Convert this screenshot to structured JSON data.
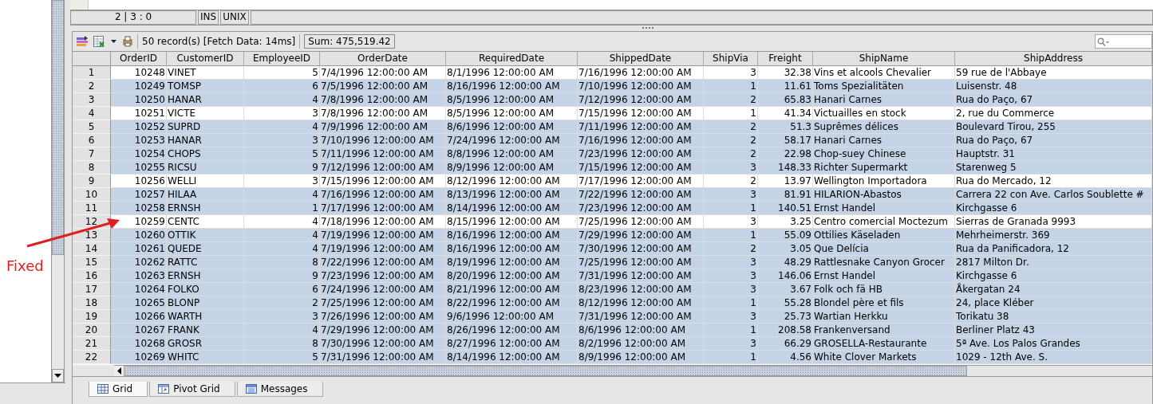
{
  "editor_status": {
    "position": "2 | 3 : 0",
    "mode": "INS",
    "line_ending": "UNIX"
  },
  "toolbar": {
    "record_info": "50 record(s) [Fetch Data: 14ms]",
    "sum": "Sum: 475,519.42"
  },
  "table": {
    "columns": [
      {
        "label": "OrderID",
        "kind": "number"
      },
      {
        "label": "CustomerID",
        "kind": "text"
      },
      {
        "label": "EmployeeID",
        "kind": "number"
      },
      {
        "label": "OrderDate",
        "kind": "text"
      },
      {
        "label": "RequiredDate",
        "kind": "text"
      },
      {
        "label": "ShippedDate",
        "kind": "text"
      },
      {
        "label": "ShipVia",
        "kind": "number"
      },
      {
        "label": "Freight",
        "kind": "number"
      },
      {
        "label": "ShipName",
        "kind": "text"
      },
      {
        "label": "ShipAddress",
        "kind": "text"
      }
    ],
    "rows": [
      {
        "number": "1",
        "selected": false,
        "cells": [
          "10248",
          "VINET",
          "5",
          "7/4/1996 12:00:00 AM",
          "8/1/1996 12:00:00 AM",
          "7/16/1996 12:00:00 AM",
          "3",
          "32.38",
          "Vins et alcools Chevalier",
          "59 rue de l'Abbaye"
        ]
      },
      {
        "number": "2",
        "selected": true,
        "cells": [
          "10249",
          "TOMSP",
          "6",
          "7/5/1996 12:00:00 AM",
          "8/16/1996 12:00:00 AM",
          "7/10/1996 12:00:00 AM",
          "1",
          "11.61",
          "Toms Spezialitäten",
          "Luisenstr. 48"
        ]
      },
      {
        "number": "3",
        "selected": true,
        "cells": [
          "10250",
          "HANAR",
          "4",
          "7/8/1996 12:00:00 AM",
          "8/5/1996 12:00:00 AM",
          "7/12/1996 12:00:00 AM",
          "2",
          "65.83",
          "Hanari Carnes",
          "Rua do Paço, 67"
        ]
      },
      {
        "number": "4",
        "selected": false,
        "cells": [
          "10251",
          "VICTE",
          "3",
          "7/8/1996 12:00:00 AM",
          "8/5/1996 12:00:00 AM",
          "7/15/1996 12:00:00 AM",
          "1",
          "41.34",
          "Victuailles en stock",
          "2, rue du Commerce"
        ]
      },
      {
        "number": "5",
        "selected": true,
        "cells": [
          "10252",
          "SUPRD",
          "4",
          "7/9/1996 12:00:00 AM",
          "8/6/1996 12:00:00 AM",
          "7/11/1996 12:00:00 AM",
          "2",
          "51.3",
          "Suprêmes délices",
          "Boulevard Tirou, 255"
        ]
      },
      {
        "number": "6",
        "selected": true,
        "cells": [
          "10253",
          "HANAR",
          "3",
          "7/10/1996 12:00:00 AM",
          "7/24/1996 12:00:00 AM",
          "7/16/1996 12:00:00 AM",
          "2",
          "58.17",
          "Hanari Carnes",
          "Rua do Paço, 67"
        ]
      },
      {
        "number": "7",
        "selected": true,
        "cells": [
          "10254",
          "CHOPS",
          "5",
          "7/11/1996 12:00:00 AM",
          "8/8/1996 12:00:00 AM",
          "7/23/1996 12:00:00 AM",
          "2",
          "22.98",
          "Chop-suey Chinese",
          "Hauptstr. 31"
        ]
      },
      {
        "number": "8",
        "selected": true,
        "cells": [
          "10255",
          "RICSU",
          "9",
          "7/12/1996 12:00:00 AM",
          "8/9/1996 12:00:00 AM",
          "7/15/1996 12:00:00 AM",
          "3",
          "148.33",
          "Richter Supermarkt",
          "Starenweg 5"
        ]
      },
      {
        "number": "9",
        "selected": false,
        "cells": [
          "10256",
          "WELLI",
          "3",
          "7/15/1996 12:00:00 AM",
          "8/12/1996 12:00:00 AM",
          "7/17/1996 12:00:00 AM",
          "2",
          "13.97",
          "Wellington Importadora",
          "Rua do Mercado, 12"
        ]
      },
      {
        "number": "10",
        "selected": true,
        "cells": [
          "10257",
          "HILAA",
          "4",
          "7/16/1996 12:00:00 AM",
          "8/13/1996 12:00:00 AM",
          "7/22/1996 12:00:00 AM",
          "3",
          "81.91",
          "HILARION-Abastos",
          "Carrera 22 con Ave. Carlos Soublette #"
        ]
      },
      {
        "number": "11",
        "selected": true,
        "cells": [
          "10258",
          "ERNSH",
          "1",
          "7/17/1996 12:00:00 AM",
          "8/14/1996 12:00:00 AM",
          "7/23/1996 12:00:00 AM",
          "1",
          "140.51",
          "Ernst Handel",
          "Kirchgasse 6"
        ]
      },
      {
        "number": "12",
        "selected": false,
        "cells": [
          "10259",
          "CENTC",
          "4",
          "7/18/1996 12:00:00 AM",
          "8/15/1996 12:00:00 AM",
          "7/25/1996 12:00:00 AM",
          "3",
          "3.25",
          "Centro comercial Moctezum",
          "Sierras de Granada 9993"
        ]
      },
      {
        "number": "13",
        "selected": true,
        "cells": [
          "10260",
          "OTTIK",
          "4",
          "7/19/1996 12:00:00 AM",
          "8/16/1996 12:00:00 AM",
          "7/29/1996 12:00:00 AM",
          "1",
          "55.09",
          "Ottilies Käseladen",
          "Mehrheimerstr. 369"
        ]
      },
      {
        "number": "14",
        "selected": true,
        "cells": [
          "10261",
          "QUEDE",
          "4",
          "7/19/1996 12:00:00 AM",
          "8/16/1996 12:00:00 AM",
          "7/30/1996 12:00:00 AM",
          "2",
          "3.05",
          "Que Delícia",
          "Rua da Panificadora, 12"
        ]
      },
      {
        "number": "15",
        "selected": true,
        "cells": [
          "10262",
          "RATTC",
          "8",
          "7/22/1996 12:00:00 AM",
          "8/19/1996 12:00:00 AM",
          "7/25/1996 12:00:00 AM",
          "3",
          "48.29",
          "Rattlesnake Canyon Grocer",
          "2817 Milton Dr."
        ]
      },
      {
        "number": "16",
        "selected": true,
        "cells": [
          "10263",
          "ERNSH",
          "9",
          "7/23/1996 12:00:00 AM",
          "8/20/1996 12:00:00 AM",
          "7/31/1996 12:00:00 AM",
          "3",
          "146.06",
          "Ernst Handel",
          "Kirchgasse 6"
        ]
      },
      {
        "number": "17",
        "selected": true,
        "cells": [
          "10264",
          "FOLKO",
          "6",
          "7/24/1996 12:00:00 AM",
          "8/21/1996 12:00:00 AM",
          "8/23/1996 12:00:00 AM",
          "3",
          "3.67",
          "Folk och fä HB",
          "Åkergatan 24"
        ]
      },
      {
        "number": "18",
        "selected": true,
        "cells": [
          "10265",
          "BLONP",
          "2",
          "7/25/1996 12:00:00 AM",
          "8/22/1996 12:00:00 AM",
          "8/12/1996 12:00:00 AM",
          "1",
          "55.28",
          "Blondel père et fils",
          "24, place Kléber"
        ]
      },
      {
        "number": "19",
        "selected": true,
        "cells": [
          "10266",
          "WARTH",
          "3",
          "7/26/1996 12:00:00 AM",
          "9/6/1996 12:00:00 AM",
          "7/31/1996 12:00:00 AM",
          "3",
          "25.73",
          "Wartian Herkku",
          "Torikatu 38"
        ]
      },
      {
        "number": "20",
        "selected": true,
        "cells": [
          "10267",
          "FRANK",
          "4",
          "7/29/1996 12:00:00 AM",
          "8/26/1996 12:00:00 AM",
          "8/6/1996 12:00:00 AM",
          "1",
          "208.58",
          "Frankenversand",
          "Berliner Platz 43"
        ]
      },
      {
        "number": "21",
        "selected": true,
        "cells": [
          "10268",
          "GROSR",
          "8",
          "7/30/1996 12:00:00 AM",
          "8/27/1996 12:00:00 AM",
          "8/2/1996 12:00:00 AM",
          "3",
          "66.29",
          "GROSELLA-Restaurante",
          "5ª Ave. Los Palos Grandes"
        ]
      },
      {
        "number": "22",
        "selected": true,
        "cells": [
          "10269",
          "WHITC",
          "5",
          "7/31/1996 12:00:00 AM",
          "8/14/1996 12:00:00 AM",
          "8/9/1996 12:00:00 AM",
          "1",
          "4.56",
          "White Clover Markets",
          "1029 - 12th Ave. S."
        ]
      }
    ]
  },
  "tabs": [
    {
      "label": "Grid",
      "selected": true
    },
    {
      "label": "Pivot Grid",
      "selected": false
    },
    {
      "label": "Messages",
      "selected": false
    }
  ],
  "annotation": {
    "text": "Fixed"
  }
}
